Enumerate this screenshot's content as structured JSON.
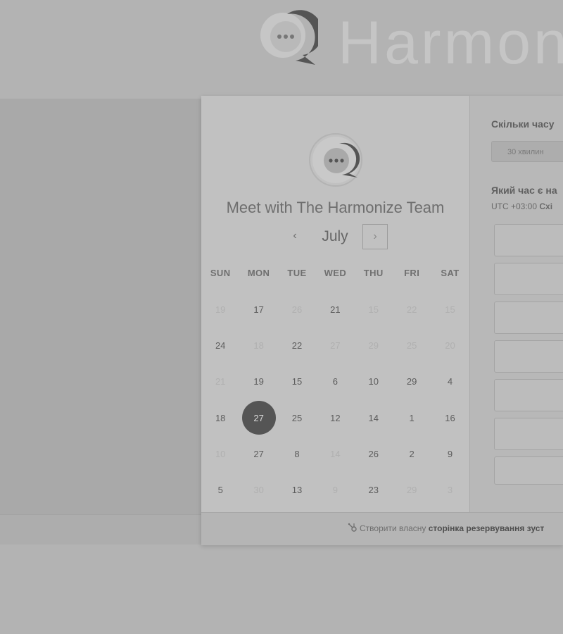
{
  "brand": {
    "wordmark": "Harmon",
    "icon": "chat-bubble-logo-icon"
  },
  "calendar": {
    "title": "Meet with The Harmonize Team",
    "month": "July",
    "prev_icon": "chevron-left-icon",
    "next_icon": "chevron-right-icon",
    "weekdays": [
      "SUN",
      "MON",
      "TUE",
      "WED",
      "THU",
      "FRI",
      "SAT"
    ],
    "weeks": [
      [
        {
          "d": "19",
          "a": false
        },
        {
          "d": "17",
          "a": true
        },
        {
          "d": "26",
          "a": false
        },
        {
          "d": "21",
          "a": true
        },
        {
          "d": "15",
          "a": false
        },
        {
          "d": "22",
          "a": false
        },
        {
          "d": "15",
          "a": false
        }
      ],
      [
        {
          "d": "24",
          "a": true
        },
        {
          "d": "18",
          "a": false
        },
        {
          "d": "22",
          "a": true
        },
        {
          "d": "27",
          "a": false
        },
        {
          "d": "29",
          "a": false
        },
        {
          "d": "25",
          "a": false
        },
        {
          "d": "20",
          "a": false
        }
      ],
      [
        {
          "d": "21",
          "a": false
        },
        {
          "d": "19",
          "a": true
        },
        {
          "d": "15",
          "a": true
        },
        {
          "d": "6",
          "a": true
        },
        {
          "d": "10",
          "a": true
        },
        {
          "d": "29",
          "a": true
        },
        {
          "d": "4",
          "a": true
        }
      ],
      [
        {
          "d": "18",
          "a": true
        },
        {
          "d": "27",
          "a": true,
          "sel": true
        },
        {
          "d": "25",
          "a": true
        },
        {
          "d": "12",
          "a": true
        },
        {
          "d": "14",
          "a": true
        },
        {
          "d": "1",
          "a": true
        },
        {
          "d": "16",
          "a": true
        }
      ],
      [
        {
          "d": "10",
          "a": false
        },
        {
          "d": "27",
          "a": true
        },
        {
          "d": "8",
          "a": true
        },
        {
          "d": "14",
          "a": false
        },
        {
          "d": "26",
          "a": true
        },
        {
          "d": "2",
          "a": true
        },
        {
          "d": "9",
          "a": true
        }
      ],
      [
        {
          "d": "5",
          "a": true
        },
        {
          "d": "30",
          "a": false
        },
        {
          "d": "13",
          "a": true
        },
        {
          "d": "9",
          "a": false
        },
        {
          "d": "23",
          "a": true
        },
        {
          "d": "29",
          "a": false
        },
        {
          "d": "3",
          "a": false
        }
      ]
    ]
  },
  "booking": {
    "duration_question": "Скільки часу",
    "duration_option": "30 хвилин",
    "time_question": "Який час є на",
    "timezone_offset": "UTC +03:00",
    "timezone_name": "Схі",
    "slot_count_visible": 7
  },
  "footer": {
    "prefix": "Створити власну",
    "link_text": "сторінка резервування зуст",
    "icon": "sprocket-icon"
  }
}
